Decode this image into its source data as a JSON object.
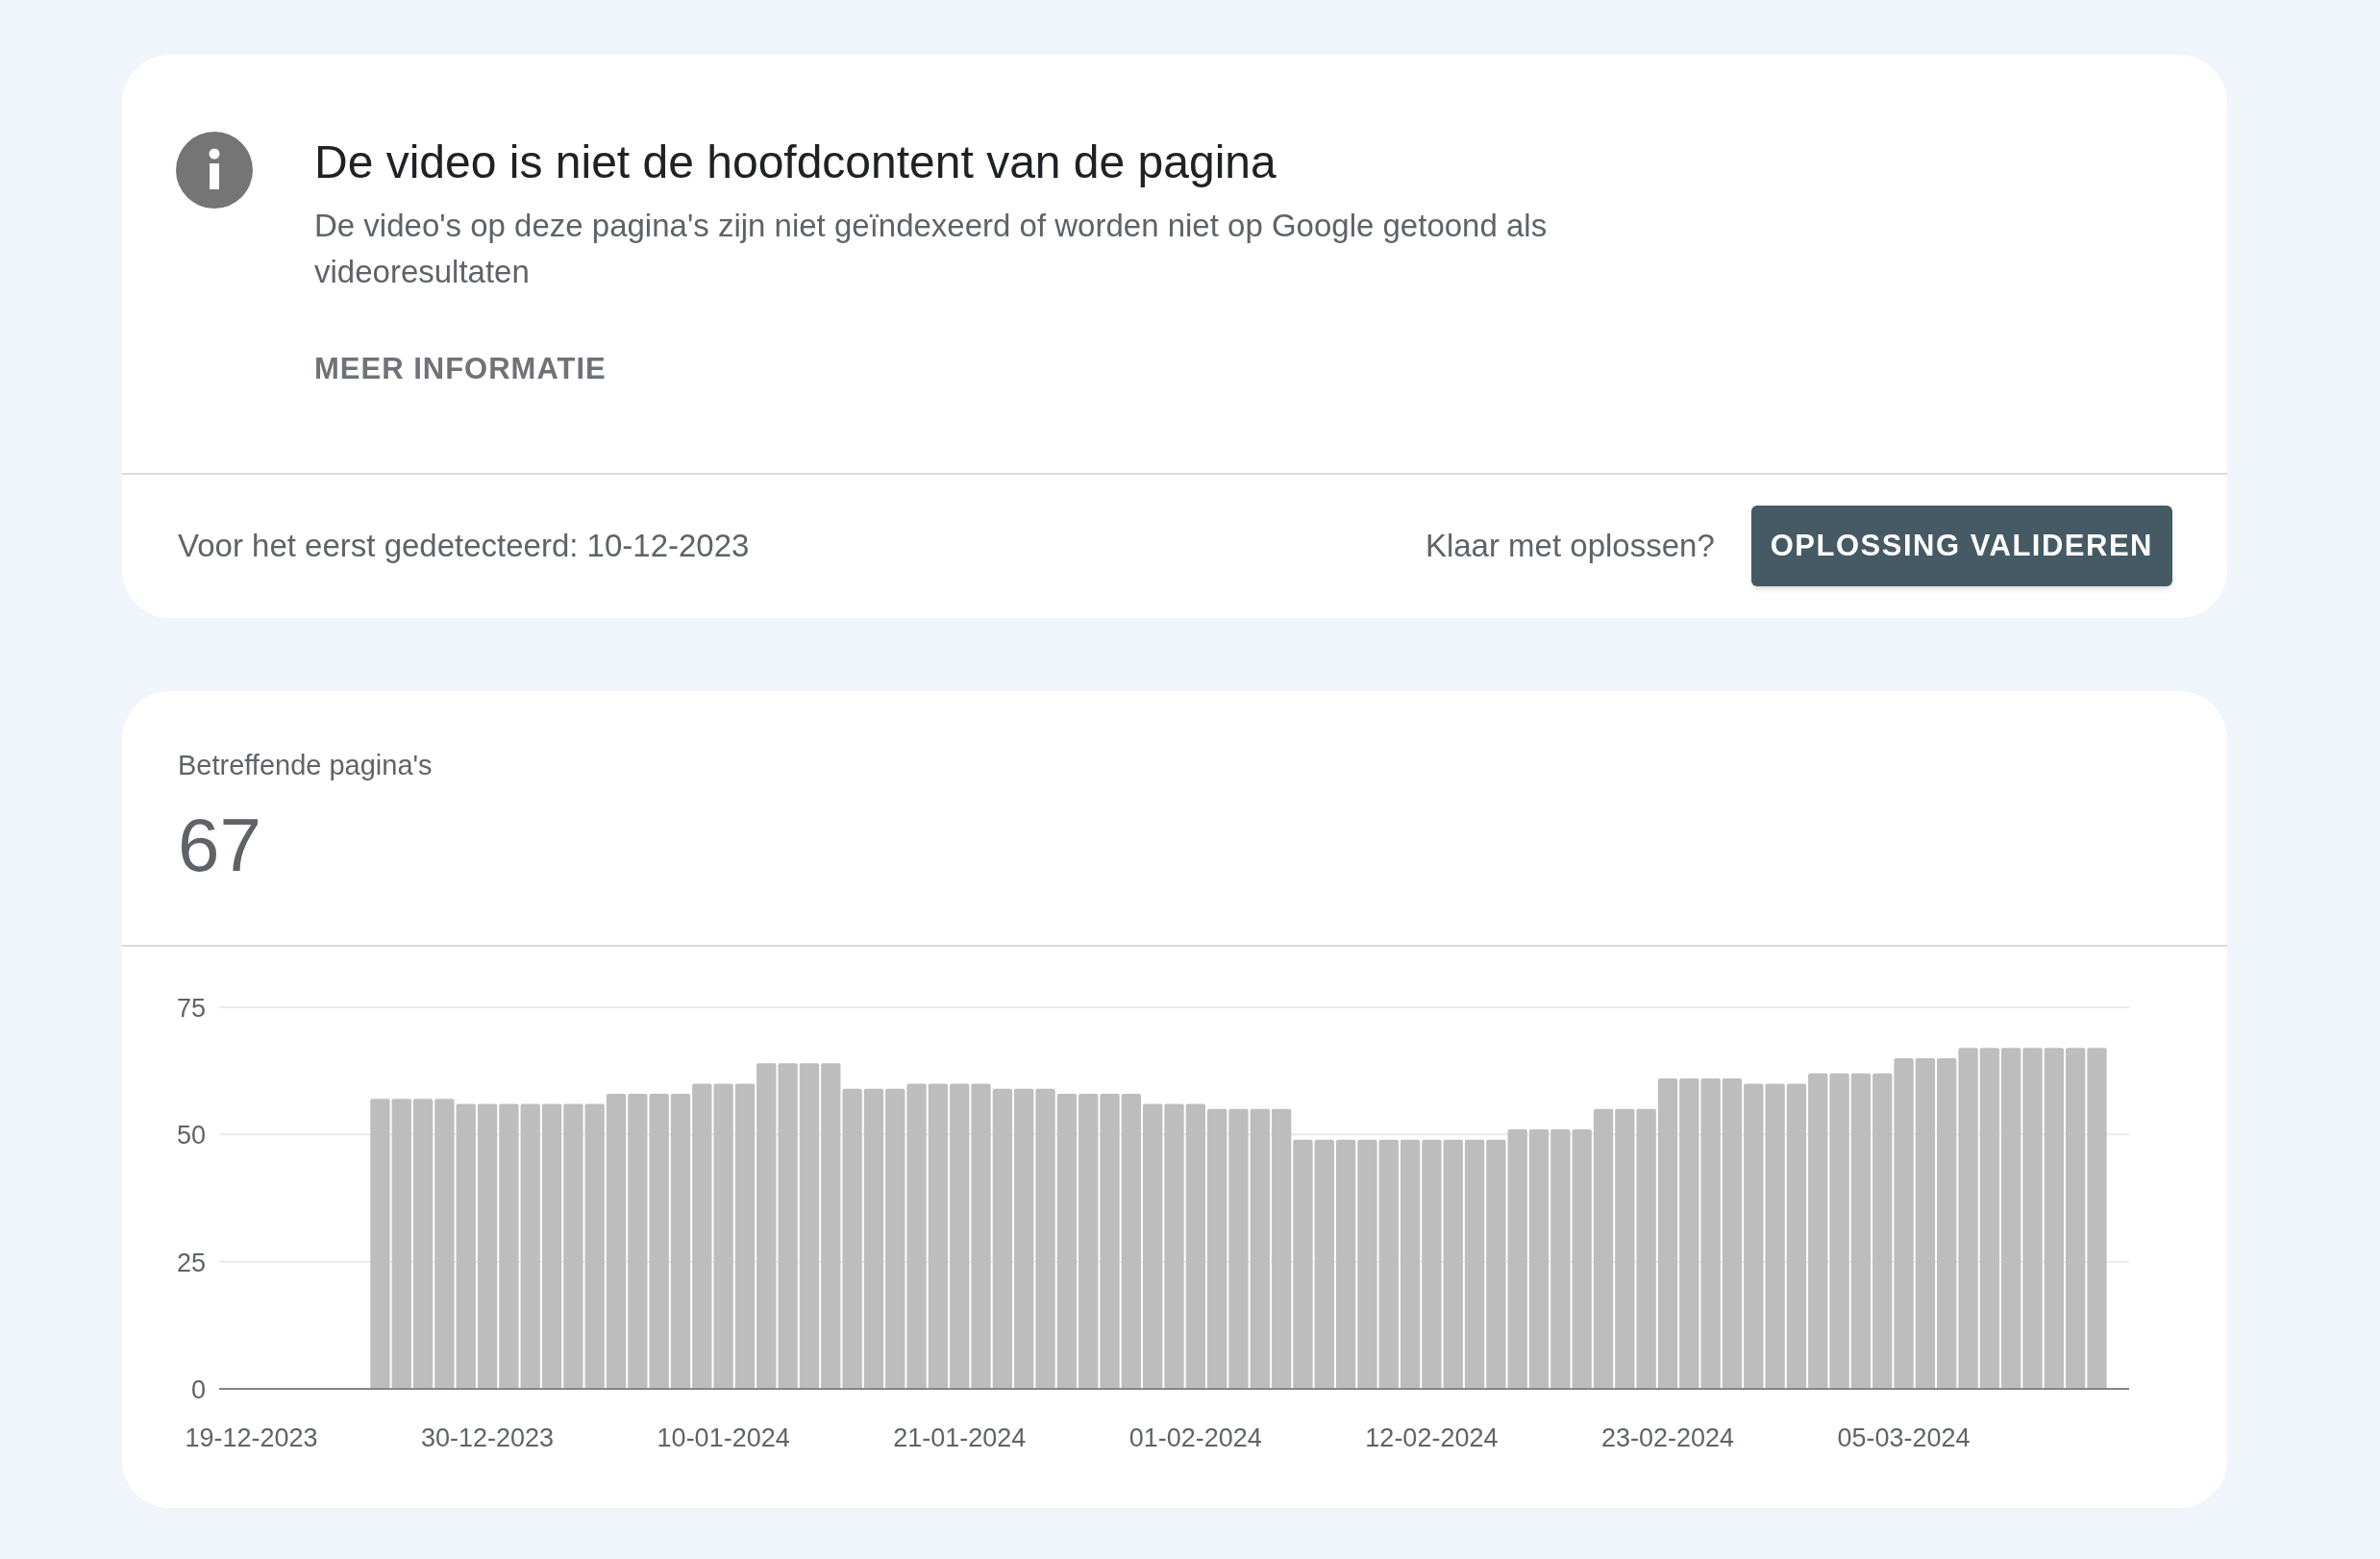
{
  "issue_card": {
    "title": "De video is niet de hoofdcontent van de pagina",
    "description": "De video's op deze pagina's zijn niet geïndexeerd of worden niet op Google getoond als videoresultaten",
    "learn_more": "MEER INFORMATIE",
    "first_detected": "Voor het eerst gedetecteerd: 10-12-2023",
    "ready_prompt": "Klaar met oplossen?",
    "validate_button": "OPLOSSING VALIDEREN"
  },
  "pages_card": {
    "label": "Betreffende pagina's",
    "count": "67",
    "chart_data": {
      "type": "bar",
      "categories": [
        null,
        "19-12-2023",
        null,
        null,
        null,
        null,
        null,
        null,
        null,
        null,
        null,
        null,
        "30-12-2023",
        null,
        null,
        null,
        null,
        null,
        null,
        null,
        null,
        null,
        null,
        "10-01-2024",
        null,
        null,
        null,
        null,
        null,
        null,
        null,
        null,
        null,
        null,
        "21-01-2024",
        null,
        null,
        null,
        null,
        null,
        null,
        null,
        null,
        null,
        null,
        "01-02-2024",
        null,
        null,
        null,
        null,
        null,
        null,
        null,
        null,
        null,
        null,
        "12-02-2024",
        null,
        null,
        null,
        null,
        null,
        null,
        null,
        null,
        null,
        null,
        "23-02-2024",
        null,
        null,
        null,
        null,
        null,
        null,
        null,
        null,
        null,
        null,
        "05-03-2024",
        null,
        null,
        null,
        null,
        null,
        null,
        null,
        null,
        null,
        null
      ],
      "series": [
        {
          "color": "#bdbdbd",
          "values": [
            null,
            null,
            null,
            null,
            null,
            null,
            null,
            57,
            57,
            57,
            57,
            56,
            56,
            56,
            56,
            56,
            56,
            56,
            58,
            58,
            58,
            58,
            60,
            60,
            60,
            64,
            64,
            64,
            64,
            59,
            59,
            59,
            60,
            60,
            60,
            60,
            59,
            59,
            59,
            58,
            58,
            58,
            58,
            56,
            56,
            56,
            55,
            55,
            55,
            55,
            49,
            49,
            49,
            49,
            49,
            49,
            49,
            49,
            49,
            49,
            51,
            51,
            51,
            51,
            55,
            55,
            55,
            61,
            61,
            61,
            61,
            60,
            60,
            60,
            62,
            62,
            62,
            62,
            65,
            65,
            65,
            67,
            67,
            67,
            67,
            67,
            67,
            67,
            null
          ]
        }
      ],
      "ylim": [
        0,
        75
      ],
      "yticks": [
        0,
        25,
        50,
        75
      ]
    }
  }
}
